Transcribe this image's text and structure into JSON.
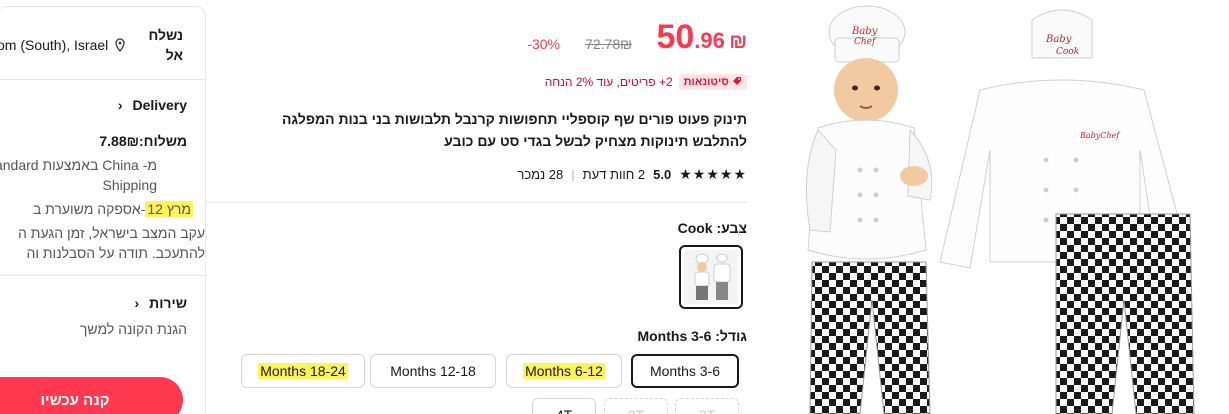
{
  "shipping": {
    "ship_to_label": "נשלח אל",
    "location": "om (South), Israel",
    "delivery_title": "Delivery",
    "shipping_cost": "משלוח:7.88₪",
    "from_line1": "מ- China באמצעות Standard",
    "from_line2": "Shipping",
    "eta_highlight": "מרץ 12",
    "eta_rest": "-אספקה משוערת ב",
    "notice_line1": "עקב המצב בישראל, זמן הגעת ה",
    "notice_line2": "להתעכב. תודה על הסבלנות וה",
    "service_title": "שירות",
    "protection": "הגנת הקונה למשך",
    "buy_now": "קנה עכשיו"
  },
  "product": {
    "price_currency": "₪",
    "price_int": "50",
    "price_dec": ".96",
    "old_price": "72.78₪",
    "discount": "30%-",
    "promo_tag": "סיטונאות",
    "promo_text": "2+ פריטים, עוד 2% הנחה",
    "title": "תינוק פעוט פורים שף קוספליי תחפושות קרנבל תלבושות בני בנות המפלגה להתלבש תינוקות מצחיק לבשל בגדי סט עם כובע",
    "rating_value": "5.0",
    "reviews": "2 חוות דעת",
    "sold": "28 נמכר",
    "color_label": "צבע: Cook",
    "size_label": "גודל: Months 3-6",
    "sizes": [
      "Months 3-6",
      "Months 6-12",
      "Months 12-18",
      "Months 18-24",
      "2T",
      "3T",
      "4T"
    ]
  },
  "colors": {
    "accent": "#fd384f",
    "highlight": "#fff35a"
  }
}
